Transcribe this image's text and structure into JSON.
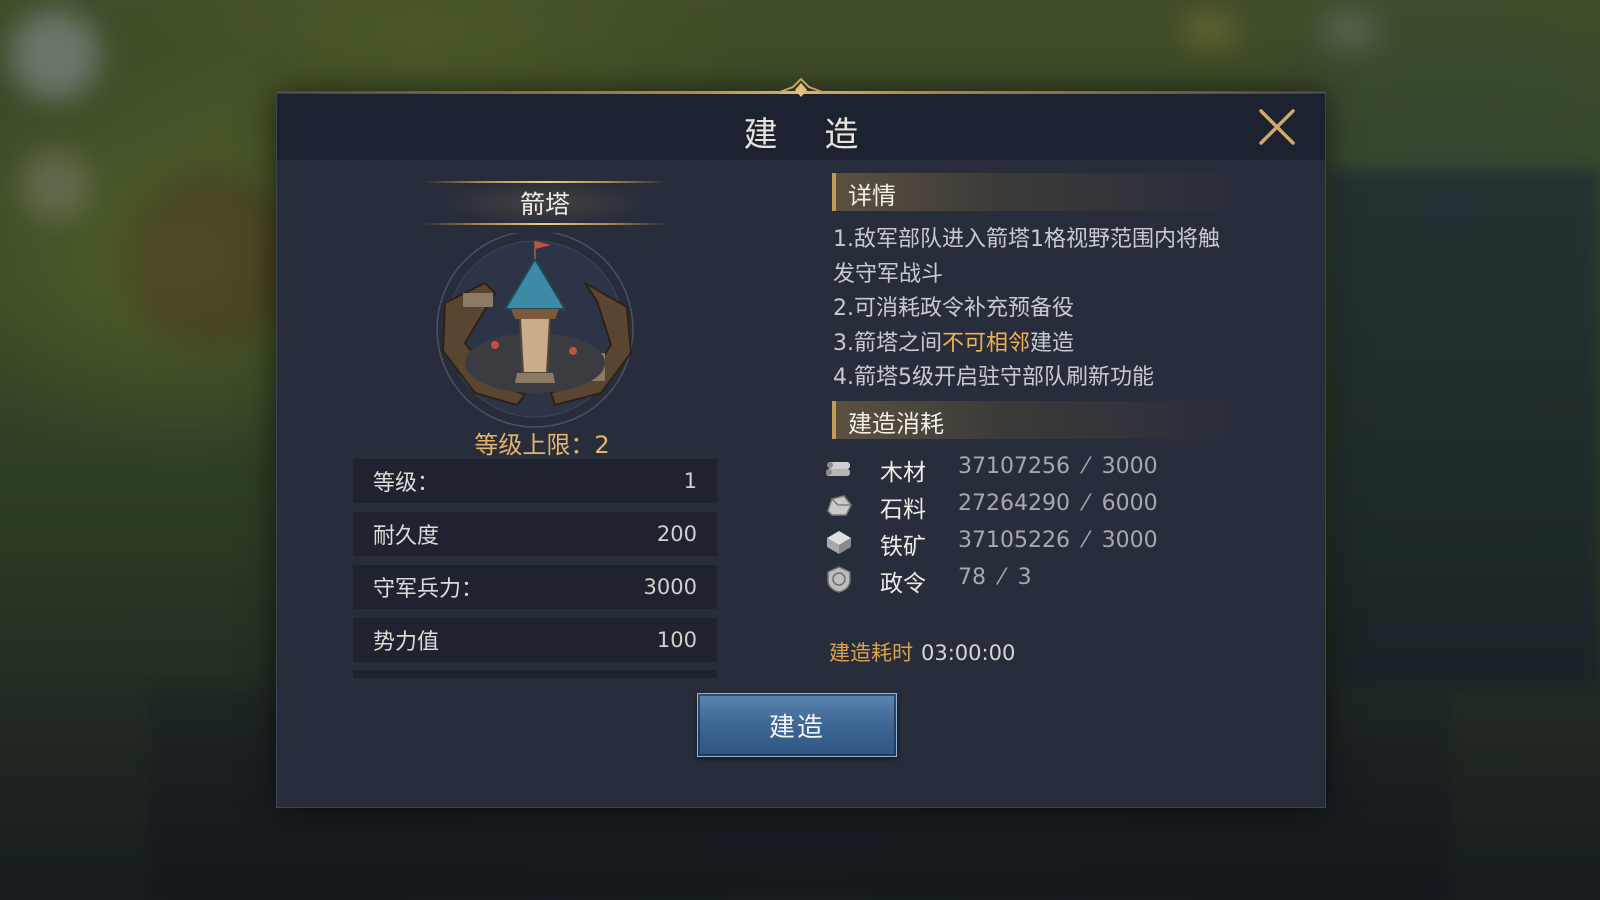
{
  "dialog": {
    "title": "建 造",
    "close_icon": "close-x-icon"
  },
  "building": {
    "name": "箭塔",
    "level_cap_label": "等级上限：2",
    "stats": [
      {
        "label": "等级：",
        "value": "1"
      },
      {
        "label": "耐久度",
        "value": "200"
      },
      {
        "label": "守军兵力：",
        "value": "3000"
      },
      {
        "label": "势力值",
        "value": "100"
      }
    ]
  },
  "details": {
    "header": "详情",
    "lines": [
      "1.敌军部队进入箭塔1格视野范围内将触",
      "发守军战斗",
      "2.可消耗政令补充预备役"
    ],
    "line3_pre": "3.箭塔之间",
    "line3_highlight": "不可相邻",
    "line3_post": "建造",
    "line4": "4.箭塔5级开启驻守部队刷新功能"
  },
  "cost": {
    "header": "建造消耗",
    "resources": [
      {
        "icon": "wood-icon",
        "name": "木材",
        "amount": "37107256  ⁄  3000"
      },
      {
        "icon": "stone-icon",
        "name": "石料",
        "amount": "27264290  ⁄  6000"
      },
      {
        "icon": "iron-ore-icon",
        "name": "铁矿",
        "amount": "37105226  ⁄  3000"
      },
      {
        "icon": "decree-icon",
        "name": "政令",
        "amount": "78  ⁄  3"
      }
    ],
    "time_label": "建造耗时",
    "time_value": "03:00:00"
  },
  "actions": {
    "build_label": "建造"
  },
  "colors": {
    "accent_gold": "#e3b46a",
    "highlight_orange": "#efb150",
    "button_blue": "#3f6896"
  }
}
